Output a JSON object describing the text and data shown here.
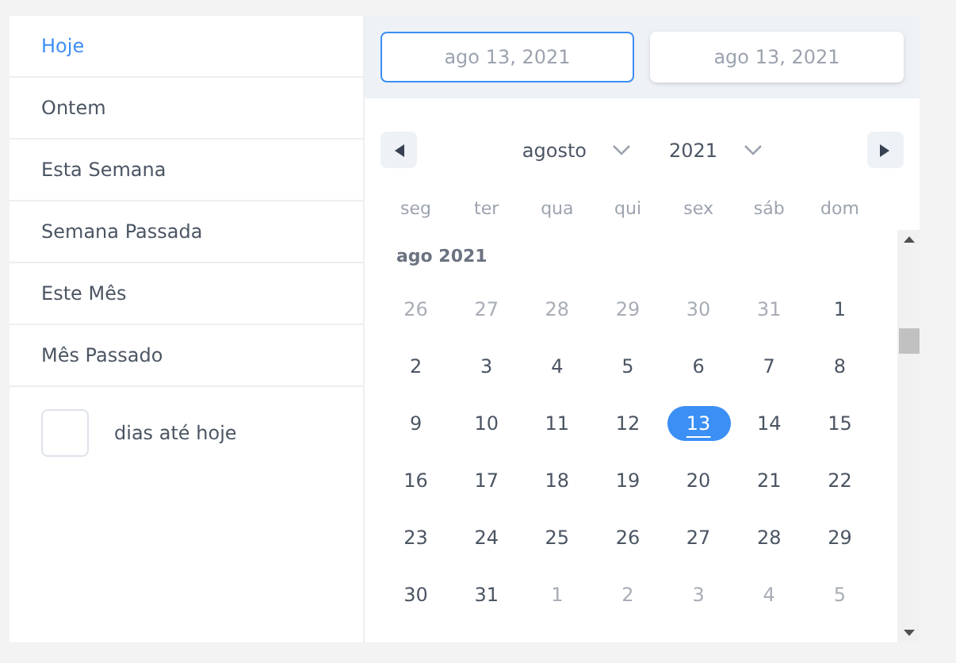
{
  "presets": [
    {
      "label": "Hoje",
      "selected": true
    },
    {
      "label": "Ontem",
      "selected": false
    },
    {
      "label": "Esta Semana",
      "selected": false
    },
    {
      "label": "Semana Passada",
      "selected": false
    },
    {
      "label": "Este Mês",
      "selected": false
    },
    {
      "label": "Mês Passado",
      "selected": false
    }
  ],
  "days_until_today": {
    "label": "dias até hoje"
  },
  "range_inputs": [
    {
      "value": "ago 13, 2021",
      "focused": true
    },
    {
      "value": "ago 13, 2021",
      "focused": false
    }
  ],
  "navigation": {
    "month": "agosto",
    "year": "2021"
  },
  "weekdays": [
    "seg",
    "ter",
    "qua",
    "qui",
    "sex",
    "sáb",
    "dom"
  ],
  "month_label": "ago 2021",
  "days": [
    {
      "text": "26",
      "outside": true,
      "selected": false
    },
    {
      "text": "27",
      "outside": true,
      "selected": false
    },
    {
      "text": "28",
      "outside": true,
      "selected": false
    },
    {
      "text": "29",
      "outside": true,
      "selected": false
    },
    {
      "text": "30",
      "outside": true,
      "selected": false
    },
    {
      "text": "31",
      "outside": true,
      "selected": false
    },
    {
      "text": "1",
      "outside": false,
      "selected": false
    },
    {
      "text": "2",
      "outside": false,
      "selected": false
    },
    {
      "text": "3",
      "outside": false,
      "selected": false
    },
    {
      "text": "4",
      "outside": false,
      "selected": false
    },
    {
      "text": "5",
      "outside": false,
      "selected": false
    },
    {
      "text": "6",
      "outside": false,
      "selected": false
    },
    {
      "text": "7",
      "outside": false,
      "selected": false
    },
    {
      "text": "8",
      "outside": false,
      "selected": false
    },
    {
      "text": "9",
      "outside": false,
      "selected": false
    },
    {
      "text": "10",
      "outside": false,
      "selected": false
    },
    {
      "text": "11",
      "outside": false,
      "selected": false
    },
    {
      "text": "12",
      "outside": false,
      "selected": false
    },
    {
      "text": "13",
      "outside": false,
      "selected": true
    },
    {
      "text": "14",
      "outside": false,
      "selected": false
    },
    {
      "text": "15",
      "outside": false,
      "selected": false
    },
    {
      "text": "16",
      "outside": false,
      "selected": false
    },
    {
      "text": "17",
      "outside": false,
      "selected": false
    },
    {
      "text": "18",
      "outside": false,
      "selected": false
    },
    {
      "text": "19",
      "outside": false,
      "selected": false
    },
    {
      "text": "20",
      "outside": false,
      "selected": false
    },
    {
      "text": "21",
      "outside": false,
      "selected": false
    },
    {
      "text": "22",
      "outside": false,
      "selected": false
    },
    {
      "text": "23",
      "outside": false,
      "selected": false
    },
    {
      "text": "24",
      "outside": false,
      "selected": false
    },
    {
      "text": "25",
      "outside": false,
      "selected": false
    },
    {
      "text": "26",
      "outside": false,
      "selected": false
    },
    {
      "text": "27",
      "outside": false,
      "selected": false
    },
    {
      "text": "28",
      "outside": false,
      "selected": false
    },
    {
      "text": "29",
      "outside": false,
      "selected": false
    },
    {
      "text": "30",
      "outside": false,
      "selected": false
    },
    {
      "text": "31",
      "outside": false,
      "selected": false
    },
    {
      "text": "1",
      "outside": true,
      "selected": false
    },
    {
      "text": "2",
      "outside": true,
      "selected": false
    },
    {
      "text": "3",
      "outside": true,
      "selected": false
    },
    {
      "text": "4",
      "outside": true,
      "selected": false
    },
    {
      "text": "5",
      "outside": true,
      "selected": false
    }
  ]
}
